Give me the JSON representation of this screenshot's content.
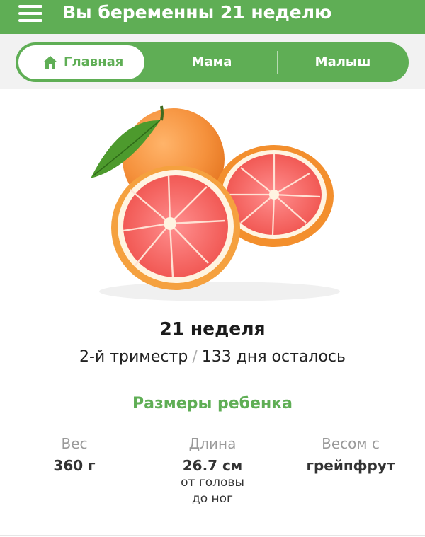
{
  "header": {
    "title": "Вы беременны 21 неделю",
    "menu_icon": "hamburger-menu-icon"
  },
  "tabs": [
    {
      "label": "Главная",
      "active": true,
      "icon": "home-icon"
    },
    {
      "label": "Мама",
      "active": false
    },
    {
      "label": "Малыш",
      "active": false
    }
  ],
  "hero": {
    "image": "grapefruit-illustration"
  },
  "week": {
    "title": "21 неделя",
    "trimester": "2-й триместр",
    "separator": "/",
    "remaining": "133 дня осталось"
  },
  "baby_size": {
    "title": "Размеры ребенка",
    "weight": {
      "label": "Вес",
      "value": "360 г"
    },
    "length": {
      "label": "Длина",
      "value": "26.7 см",
      "sub_line1": "от головы",
      "sub_line2": "до ног"
    },
    "size_like": {
      "label": "Весом с",
      "value": "грейпфрут"
    }
  },
  "colors": {
    "accent": "#5fae55",
    "header_bg": "#5fae55",
    "tab_zone_bg": "#f2f2f2"
  }
}
